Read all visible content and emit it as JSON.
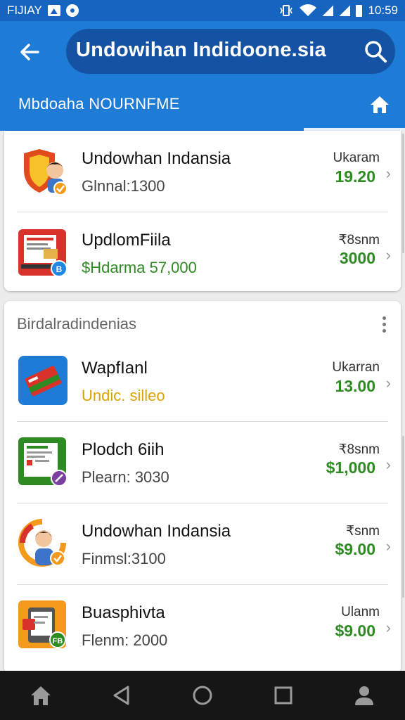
{
  "status_bar": {
    "carrier": "FIJIAY",
    "time": "10:59",
    "icons": [
      "notification-box-icon",
      "circle-app-icon",
      "vibrate-icon",
      "wifi-icon",
      "signal-icon",
      "battery-icon"
    ]
  },
  "app_bar": {
    "back_icon": "arrow-left-icon",
    "search_text": "Undowihan Indidoone.sia",
    "search_icon": "search-icon",
    "subtitle": "Mbdoaha NOURNFME",
    "home_icon": "home-icon",
    "color": "#1e7bd6"
  },
  "card1": {
    "rows": [
      {
        "title": "Undowhan Indansia",
        "subtitle": "Glnnal:1300",
        "label": "Ukaram",
        "price": "19.20",
        "icon": "shield-person-icon",
        "badge": "check-badge"
      },
      {
        "title": "UpdlomFiila",
        "subtitle": "$Hdarma 57,000",
        "label": "₹8snm",
        "price": "3000",
        "icon": "laptop-store-icon",
        "badge": "B"
      }
    ]
  },
  "card2": {
    "section_title": "Birdalradindenias",
    "rows": [
      {
        "title": "WapfIanl",
        "subtitle": "Undic. silleo",
        "label": "Ukarran",
        "price": "13.00",
        "icon": "wallet-card-icon"
      },
      {
        "title": "Plodch 6iih",
        "subtitle": "Plearn: 3030",
        "label": "₹8snm",
        "price": "$1,000",
        "icon": "document-app-icon",
        "badge": "check-badge"
      },
      {
        "title": "Undowhan Indansia",
        "subtitle": "Finmsl:3100",
        "label": "₹snm",
        "price": "$9.00",
        "icon": "person-avatar-icon",
        "badge": "check-badge"
      },
      {
        "title": "Buasphivta",
        "subtitle": "Flenm: 2000",
        "label": "Ulanm",
        "price": "$9.00",
        "icon": "phone-app-icon",
        "badge": "FB"
      }
    ]
  },
  "nav_bar": {
    "buttons": [
      "home-icon",
      "back-triangle-icon",
      "circle-home-icon",
      "square-recents-icon",
      "person-icon"
    ]
  }
}
